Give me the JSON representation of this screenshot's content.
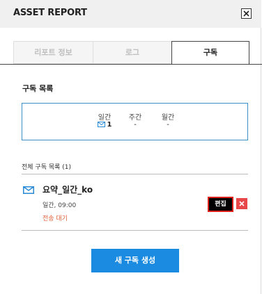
{
  "header": {
    "title": "ASSET REPORT"
  },
  "tabs": [
    {
      "label": "리포트 정보",
      "active": false
    },
    {
      "label": "로그",
      "active": false
    },
    {
      "label": "구독",
      "active": true
    }
  ],
  "subscription_list": {
    "title": "구독 목록",
    "columns": [
      {
        "label": "일간",
        "value": "1",
        "has_icon": true
      },
      {
        "label": "주간",
        "value": "-"
      },
      {
        "label": "월간",
        "value": "-"
      }
    ]
  },
  "all_subscriptions": {
    "title": "전체 구독 목록 (1)",
    "items": [
      {
        "icon": "mail-icon",
        "name": "요약_일간_ko",
        "schedule": "일간, 09:00",
        "status": "전송 대기",
        "edit_label": "편집"
      }
    ]
  },
  "create_button": {
    "label": "새 구독 생성"
  },
  "colors": {
    "accent_blue": "#1a8be0",
    "box_border": "#3a8fc7",
    "status_orange": "#e0623a",
    "delete_red": "#e8474a",
    "header_bg": "#f0f0f0"
  }
}
